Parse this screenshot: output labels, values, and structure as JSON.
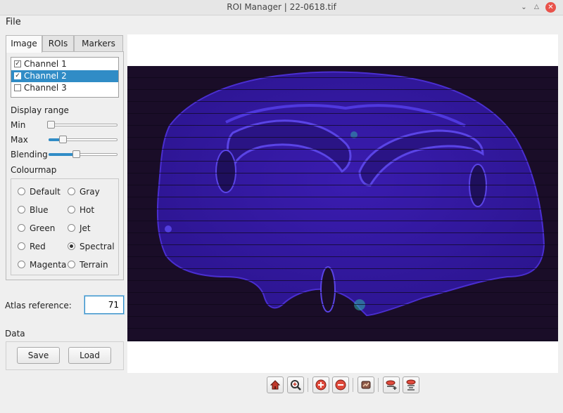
{
  "window": {
    "title": "ROI Manager  |  22-0618.tif"
  },
  "menu": {
    "file": "File"
  },
  "tabs": [
    {
      "label": "Image",
      "active": true
    },
    {
      "label": "ROIs",
      "active": false
    },
    {
      "label": "Markers",
      "active": false
    }
  ],
  "channels": [
    {
      "label": "Channel 1",
      "checked": true,
      "selected": false
    },
    {
      "label": "Channel 2",
      "checked": true,
      "selected": true
    },
    {
      "label": "Channel 3",
      "checked": false,
      "selected": false
    }
  ],
  "display_range": {
    "heading": "Display range",
    "min_label": "Min",
    "max_label": "Max",
    "blending_label": "Blending",
    "min_value": 0.03,
    "max_value": 0.2,
    "blending_value": 0.4
  },
  "colourmap": {
    "heading": "Colourmap",
    "options": [
      "Default",
      "Gray",
      "Blue",
      "Hot",
      "Green",
      "Jet",
      "Red",
      "Spectral",
      "Magenta",
      "Terrain"
    ],
    "selected": "Spectral"
  },
  "atlas": {
    "label": "Atlas reference:",
    "value": "71"
  },
  "data_section": {
    "heading": "Data",
    "save_label": "Save",
    "load_label": "Load"
  },
  "toolbar": {
    "tools": [
      "home-icon",
      "zoom-to-rect-icon",
      "zoom-in-icon",
      "zoom-out-icon",
      "pan-icon",
      "add-roi-icon",
      "remove-roi-icon"
    ]
  },
  "colors": {
    "accent": "#308cc6",
    "image_background": "#1a0d28",
    "tissue": "#3d1fb8",
    "close": "#e9524a"
  }
}
